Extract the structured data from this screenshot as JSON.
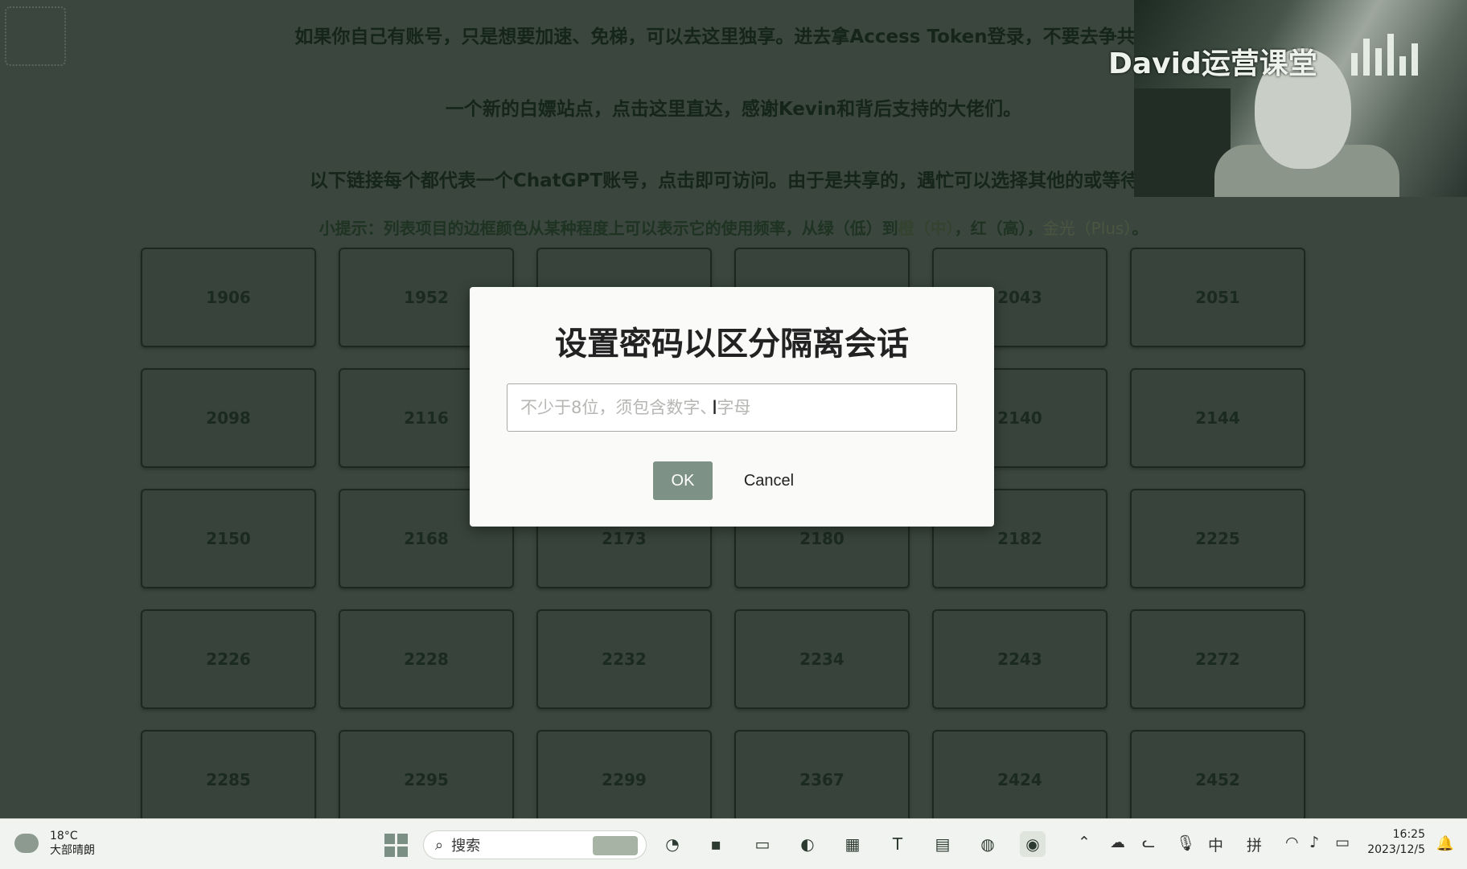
{
  "page": {
    "notice1": "如果你自己有账号，只是想要加速、免梯，可以去这里独享。进去拿Access Token登录，不要去争共享的",
    "notice2": "一个新的白嫖站点，点击这里直达，感谢Kevin和背后支持的大佬们。",
    "notice3": "以下链接每个都代表一个ChatGPT账号，点击即可访问。由于是共享的，遇忙可以选择其他的或等待一",
    "hint_prefix": "小提示：列表项目的边框颜色从某种程度上可以表示它的使用频率，从绿（低）到",
    "hint_orange": "橙（中）",
    "hint_mid": "，红（高），",
    "hint_gold": "金光（Plus）",
    "hint_end": "。",
    "accounts": [
      "1906",
      "1952",
      "",
      "",
      "2043",
      "2051",
      "2098",
      "2116",
      "",
      "",
      "2140",
      "2144",
      "2150",
      "2168",
      "2173",
      "2180",
      "2182",
      "2225",
      "2226",
      "2228",
      "2232",
      "2234",
      "2243",
      "2272",
      "2285",
      "2295",
      "2299",
      "2367",
      "2424",
      "2452"
    ]
  },
  "overlay": {
    "streamer_title": "David运营课堂"
  },
  "modal": {
    "title": "设置密码以区分隔离会话",
    "input_value": "",
    "input_placeholder": "不少于8位，须包含数字、字母",
    "ok_label": "OK",
    "cancel_label": "Cancel",
    "ok_color": "#7e9186"
  },
  "taskbar": {
    "weather_temp": "18°C",
    "weather_desc": "大部晴朗",
    "search_label": "搜索",
    "apps": [
      "pre-icon",
      "terminal-icon",
      "file-explorer-icon",
      "edge-icon",
      "calculator-icon",
      "typora-icon",
      "notepad-icon",
      "app-icon",
      "ulv-icon"
    ],
    "tray": {
      "ime_lang": "中",
      "ime_mode": "拼"
    },
    "clock_time": "16:25",
    "clock_date": "2023/12/5"
  }
}
